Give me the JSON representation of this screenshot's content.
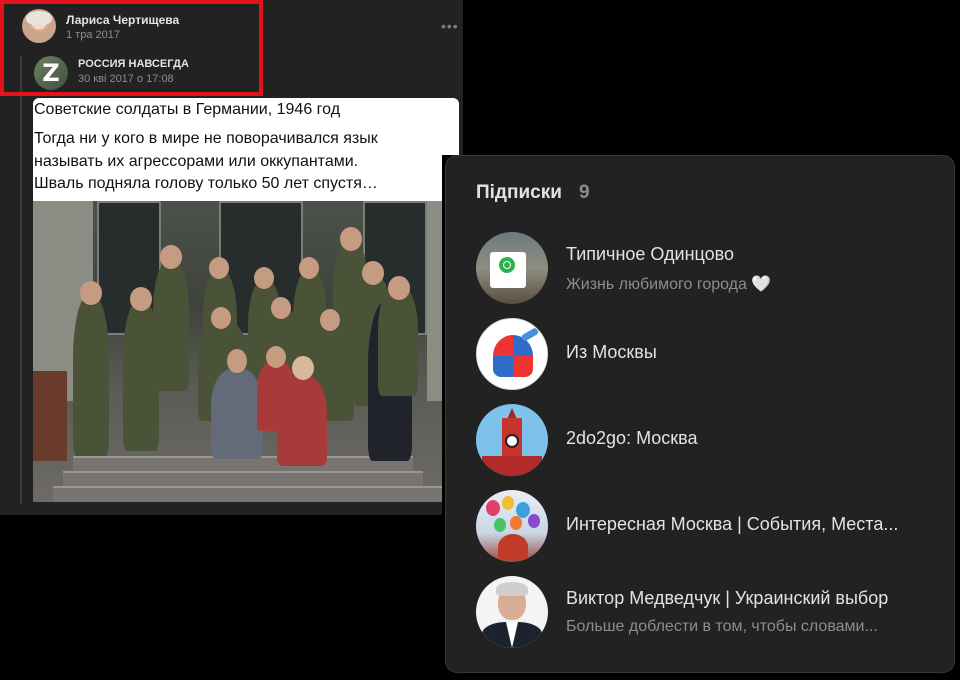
{
  "post": {
    "author_name": "Лариса Чертищева",
    "date": "1 тра 2017",
    "more_icon": "more-horizontal-icon",
    "more_glyph": "•••",
    "repost": {
      "avatar_letter": "Z",
      "name": "РОССИЯ НАВСЕГДА",
      "date": "30 кві 2017 о 17:08"
    },
    "title": "Советские солдаты в Германии, 1946 год",
    "text": "Тогда ни у кого в мире не поворачивался язык\nназывать их агрессорами или оккупантами.\nШваль подняла голову только 50 лет спустя…",
    "highlight_color": "#e3131b"
  },
  "subscriptions": {
    "title": "Підписки",
    "count": "9",
    "items": [
      {
        "name": "Типичное Одинцово",
        "description": "Жизнь любимого города 🤍"
      },
      {
        "name": "Из Москвы",
        "description": ""
      },
      {
        "name": "2do2go: Москва",
        "description": ""
      },
      {
        "name": "Интересная Москва | События, Места...",
        "description": ""
      },
      {
        "name": "Виктор Медведчук | Украинский выбор",
        "description": "Больше доблести в том, чтобы словами..."
      }
    ]
  },
  "colors": {
    "panel_bg": "#222222",
    "text_primary": "#e1e3e6",
    "text_secondary": "#8a8d91"
  }
}
